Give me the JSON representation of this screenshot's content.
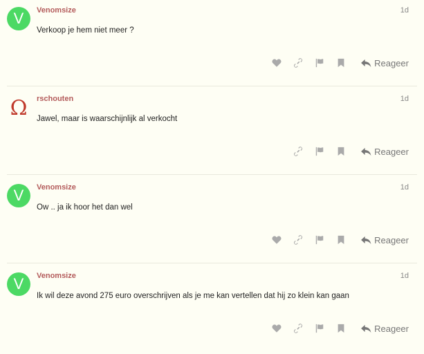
{
  "posts": [
    {
      "username": "Venomsize",
      "avatar_letter": "V",
      "avatar_color": "#4cd964",
      "time": "1d",
      "body": "Verkoop je hem niet meer ?",
      "show_like": true,
      "reply_label": "Reageer"
    },
    {
      "username": "rschouten",
      "avatar_letter": "Ω",
      "avatar_color": "#c0392b",
      "time": "1d",
      "body": "Jawel, maar is waarschijnlijk al verkocht",
      "show_like": false,
      "reply_label": "Reageer"
    },
    {
      "username": "Venomsize",
      "avatar_letter": "V",
      "avatar_color": "#4cd964",
      "time": "1d",
      "body": "Ow .. ja ik hoor het dan wel",
      "show_like": true,
      "reply_label": "Reageer"
    },
    {
      "username": "Venomsize",
      "avatar_letter": "V",
      "avatar_color": "#4cd964",
      "time": "1d",
      "body": "Ik wil deze avond 275 euro overschrijven als je me kan vertellen dat hij zo klein kan gaan",
      "show_like": true,
      "reply_label": "Reageer"
    }
  ],
  "icons": {
    "like": "heart-icon",
    "link": "link-icon",
    "flag": "flag-icon",
    "bookmark": "bookmark-icon",
    "reply": "reply-icon"
  },
  "colors": {
    "background": "#fefef4",
    "username": "#b35a5a",
    "icon": "#aaaaaa"
  }
}
